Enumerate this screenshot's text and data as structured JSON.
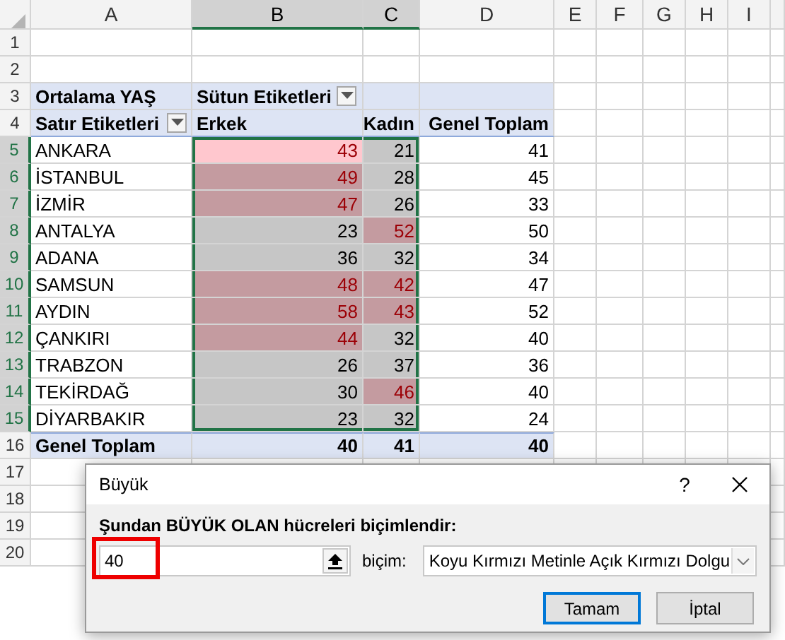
{
  "sheet": {
    "columns": [
      {
        "label": "A",
        "selected": false
      },
      {
        "label": "B",
        "selected": true
      },
      {
        "label": "C",
        "selected": true
      },
      {
        "label": "D",
        "selected": false
      },
      {
        "label": "E",
        "selected": false
      },
      {
        "label": "F",
        "selected": false
      },
      {
        "label": "G",
        "selected": false
      },
      {
        "label": "H",
        "selected": false
      },
      {
        "label": "I",
        "selected": false
      }
    ],
    "rows": [
      {
        "number": "1",
        "selected": false
      },
      {
        "number": "2",
        "selected": false
      },
      {
        "number": "3",
        "selected": false
      },
      {
        "number": "4",
        "selected": false
      },
      {
        "number": "5",
        "selected": true
      },
      {
        "number": "6",
        "selected": true
      },
      {
        "number": "7",
        "selected": true
      },
      {
        "number": "8",
        "selected": true
      },
      {
        "number": "9",
        "selected": true
      },
      {
        "number": "10",
        "selected": true
      },
      {
        "number": "11",
        "selected": true
      },
      {
        "number": "12",
        "selected": true
      },
      {
        "number": "13",
        "selected": true
      },
      {
        "number": "14",
        "selected": true
      },
      {
        "number": "15",
        "selected": true
      },
      {
        "number": "16",
        "selected": false
      },
      {
        "number": "17",
        "selected": false
      },
      {
        "number": "18",
        "selected": false
      },
      {
        "number": "19",
        "selected": false
      },
      {
        "number": "20",
        "selected": false
      }
    ]
  },
  "pivot": {
    "value_field": "Ortalama YAŞ",
    "column_labels": "Sütun Etiketleri",
    "row_labels": "Satır Etiketleri",
    "headers": [
      "Erkek",
      "Kadın",
      "Genel Toplam"
    ],
    "rows": [
      {
        "label": "ANKARA",
        "erkek": {
          "value": "43",
          "highlighted": true,
          "active": true
        },
        "kadin": {
          "value": "21",
          "highlighted": false,
          "active": false
        },
        "total": "41"
      },
      {
        "label": "İSTANBUL",
        "erkek": {
          "value": "49",
          "highlighted": true,
          "active": false
        },
        "kadin": {
          "value": "28",
          "highlighted": false,
          "active": false
        },
        "total": "45"
      },
      {
        "label": "İZMİR",
        "erkek": {
          "value": "47",
          "highlighted": true,
          "active": false
        },
        "kadin": {
          "value": "26",
          "highlighted": false,
          "active": false
        },
        "total": "33"
      },
      {
        "label": "ANTALYA",
        "erkek": {
          "value": "23",
          "highlighted": false,
          "active": false
        },
        "kadin": {
          "value": "52",
          "highlighted": true,
          "active": false
        },
        "total": "50"
      },
      {
        "label": "ADANA",
        "erkek": {
          "value": "36",
          "highlighted": false,
          "active": false
        },
        "kadin": {
          "value": "32",
          "highlighted": false,
          "active": false
        },
        "total": "34"
      },
      {
        "label": "SAMSUN",
        "erkek": {
          "value": "48",
          "highlighted": true,
          "active": false
        },
        "kadin": {
          "value": "42",
          "highlighted": true,
          "active": false
        },
        "total": "47"
      },
      {
        "label": "AYDIN",
        "erkek": {
          "value": "58",
          "highlighted": true,
          "active": false
        },
        "kadin": {
          "value": "43",
          "highlighted": true,
          "active": false
        },
        "total": "52"
      },
      {
        "label": "ÇANKIRI",
        "erkek": {
          "value": "44",
          "highlighted": true,
          "active": false
        },
        "kadin": {
          "value": "32",
          "highlighted": false,
          "active": false
        },
        "total": "40"
      },
      {
        "label": "TRABZON",
        "erkek": {
          "value": "26",
          "highlighted": false,
          "active": false
        },
        "kadin": {
          "value": "37",
          "highlighted": false,
          "active": false
        },
        "total": "36"
      },
      {
        "label": "TEKİRDAĞ",
        "erkek": {
          "value": "30",
          "highlighted": false,
          "active": false
        },
        "kadin": {
          "value": "46",
          "highlighted": true,
          "active": false
        },
        "total": "40"
      },
      {
        "label": "DİYARBAKIR",
        "erkek": {
          "value": "23",
          "highlighted": false,
          "active": false
        },
        "kadin": {
          "value": "32",
          "highlighted": false,
          "active": false
        },
        "total": "24"
      }
    ],
    "total": {
      "label": "Genel Toplam",
      "values": [
        "40",
        "41",
        "40"
      ]
    }
  },
  "dialog": {
    "title": "Büyük",
    "help": "?",
    "instruction": "Şundan BÜYÜK OLAN hücreleri biçimlendir:",
    "value": "40",
    "value_highlighted": true,
    "format_label": "biçim:",
    "format_value": "Koyu Kırmızı Metinle Açık Kırmızı Dolgu",
    "buttons": [
      {
        "label": "Tamam",
        "default": true
      },
      {
        "label": "İptal",
        "default": false
      }
    ]
  }
}
